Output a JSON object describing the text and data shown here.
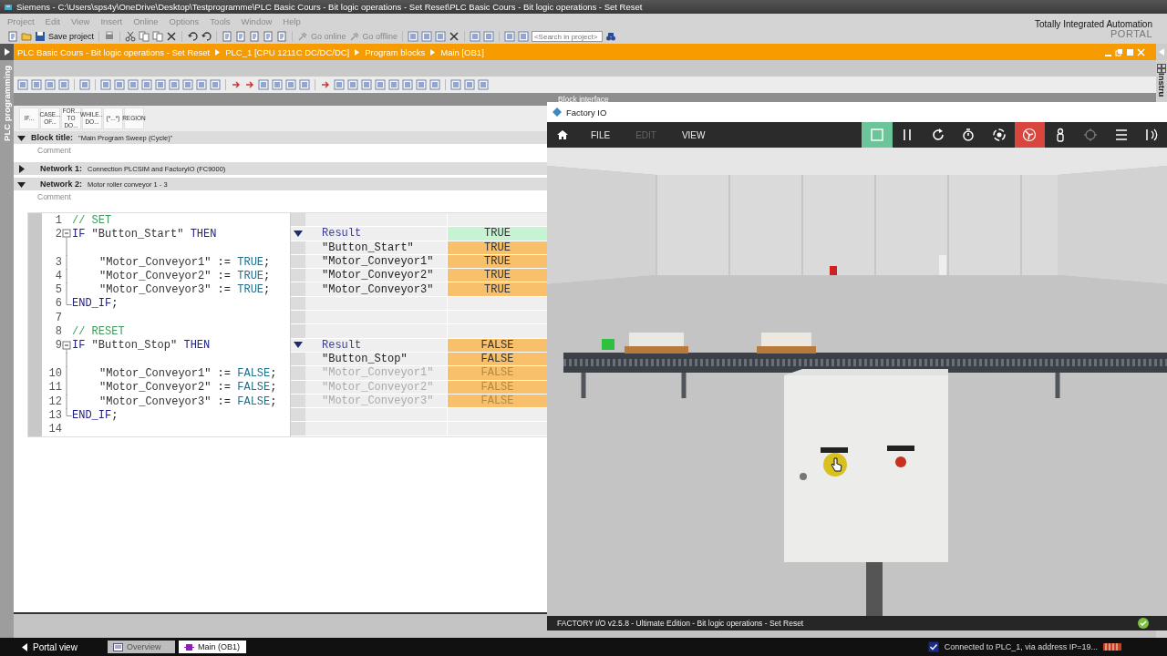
{
  "tia": {
    "title": "Siemens  -  C:\\Users\\sps4y\\OneDrive\\Desktop\\Testprogramme\\PLC Basic Cours - Bit logic operations - Set Reset\\PLC Basic Cours - Bit logic operations - Set Reset",
    "menu": [
      "Project",
      "Edit",
      "View",
      "Insert",
      "Online",
      "Options",
      "Tools",
      "Window",
      "Help"
    ],
    "save_label": "Save project",
    "go_online": "Go online",
    "go_offline": "Go offline",
    "search_placeholder": "<Search in project>",
    "brand": {
      "line1": "Totally Integrated Automation",
      "line2": "PORTAL"
    }
  },
  "breadcrumb": [
    "PLC Basic Cours - Bit logic operations - Set Reset",
    "PLC_1 [CPU 1211C DC/DC/DC]",
    "Program blocks",
    "Main [OB1]"
  ],
  "side_tab": "PLC programming",
  "right_tab": "Instru",
  "block_interface": "Block interface",
  "templates": [
    [
      "IF..."
    ],
    [
      "CASE...",
      "OF..."
    ],
    [
      "FOR...",
      "TO DO..."
    ],
    [
      "WHILE...",
      "DO..."
    ],
    [
      "(*...*)"
    ],
    [
      "REGION"
    ]
  ],
  "block_title": {
    "label": "Block title:",
    "value": "\"Main Program Sweep (Cycle)\"",
    "expanded": true,
    "comment": "Comment"
  },
  "networks": [
    {
      "label": "Network 1:",
      "title": "Connection PLCSIM and FactoryIO (FC9000)",
      "expanded": false
    },
    {
      "label": "Network 2:",
      "title": "Motor roller conveyor 1 - 3",
      "expanded": true,
      "comment": "Comment"
    }
  ],
  "code_lines": [
    {
      "number": "1",
      "kind": "plain",
      "tokens": [
        {
          "kind": "comment",
          "text": "// SET"
        }
      ]
    },
    {
      "number": "2",
      "kind": "block_start",
      "tokens": [
        {
          "kind": "keyword",
          "text": "IF"
        },
        {
          "kind": "string",
          "text": " \"Button_Start\""
        },
        {
          "kind": "keyword",
          "text": " THEN"
        }
      ]
    },
    {
      "number": "3",
      "kind": "block_inner",
      "tokens": [
        {
          "kind": "string",
          "text": "\"Motor_Conveyor1\""
        },
        {
          "kind": "plain",
          "text": " := "
        },
        {
          "kind": "constant",
          "text": "TRUE"
        },
        {
          "kind": "plain",
          "text": ";"
        }
      ]
    },
    {
      "number": "4",
      "kind": "block_inner",
      "tokens": [
        {
          "kind": "string",
          "text": "\"Motor_Conveyor2\""
        },
        {
          "kind": "plain",
          "text": " := "
        },
        {
          "kind": "constant",
          "text": "TRUE"
        },
        {
          "kind": "plain",
          "text": ";"
        }
      ]
    },
    {
      "number": "5",
      "kind": "block_inner",
      "tokens": [
        {
          "kind": "string",
          "text": "\"Motor_Conveyor3\""
        },
        {
          "kind": "plain",
          "text": " := "
        },
        {
          "kind": "constant",
          "text": "TRUE"
        },
        {
          "kind": "plain",
          "text": ";"
        }
      ]
    },
    {
      "number": "6",
      "kind": "block_end",
      "tokens": [
        {
          "kind": "keyword",
          "text": "END_IF"
        },
        {
          "kind": "plain",
          "text": ";"
        }
      ]
    },
    {
      "number": "7",
      "kind": "plain"
    },
    {
      "number": "8",
      "kind": "plain",
      "tokens": [
        {
          "kind": "comment",
          "text": "// RESET"
        }
      ]
    },
    {
      "number": "9",
      "kind": "block_start",
      "tokens": [
        {
          "kind": "keyword",
          "text": "IF"
        },
        {
          "kind": "string",
          "text": " \"Button_Stop\""
        },
        {
          "kind": "keyword",
          "text": " THEN"
        }
      ]
    },
    {
      "number": "10",
      "kind": "block_inner",
      "tokens": [
        {
          "kind": "string",
          "text": "\"Motor_Conveyor1\""
        },
        {
          "kind": "plain",
          "text": " := "
        },
        {
          "kind": "constant",
          "text": "FALSE"
        },
        {
          "kind": "plain",
          "text": ";"
        }
      ]
    },
    {
      "number": "11",
      "kind": "block_inner",
      "tokens": [
        {
          "kind": "string",
          "text": "\"Motor_Conveyor2\""
        },
        {
          "kind": "plain",
          "text": " := "
        },
        {
          "kind": "constant",
          "text": "FALSE"
        },
        {
          "kind": "plain",
          "text": ";"
        }
      ]
    },
    {
      "number": "12",
      "kind": "block_inner",
      "tokens": [
        {
          "kind": "string",
          "text": "\"Motor_Conveyor3\""
        },
        {
          "kind": "plain",
          "text": " := "
        },
        {
          "kind": "constant",
          "text": "FALSE"
        },
        {
          "kind": "plain",
          "text": ";"
        }
      ]
    },
    {
      "number": "13",
      "kind": "block_end",
      "tokens": [
        {
          "kind": "keyword",
          "text": "END_IF"
        },
        {
          "kind": "plain",
          "text": ";"
        }
      ]
    },
    {
      "number": "14",
      "kind": "plain"
    }
  ],
  "monitor_rows": [
    {
      "kind": "blank"
    },
    {
      "kind": "result",
      "operand": "Result",
      "value": "TRUE",
      "color": "#c6f3d2",
      "expanded": true,
      "disabled": false
    },
    {
      "kind": "operand",
      "operand": "\"Button_Start\"",
      "value": "TRUE",
      "color": "#f8c06a",
      "disabled": false
    },
    {
      "kind": "operand",
      "operand": "\"Motor_Conveyor1\"",
      "value": "TRUE",
      "color": "#f8c06a",
      "disabled": false
    },
    {
      "kind": "operand",
      "operand": "\"Motor_Conveyor2\"",
      "value": "TRUE",
      "color": "#f8c06a",
      "disabled": false
    },
    {
      "kind": "operand",
      "operand": "\"Motor_Conveyor3\"",
      "value": "TRUE",
      "color": "#f8c06a",
      "disabled": false
    },
    {
      "kind": "blank"
    },
    {
      "kind": "blank"
    },
    {
      "kind": "blank"
    },
    {
      "kind": "result",
      "operand": "Result",
      "value": "FALSE",
      "color": "#f8c06a",
      "expanded": true,
      "disabled": false
    },
    {
      "kind": "operand",
      "operand": "\"Button_Stop\"",
      "value": "FALSE",
      "color": "#f8c06a",
      "disabled": false
    },
    {
      "kind": "operand",
      "operand": "\"Motor_Conveyor1\"",
      "value": "FALSE",
      "color": "#f8c06a",
      "disabled": true
    },
    {
      "kind": "operand",
      "operand": "\"Motor_Conveyor2\"",
      "value": "FALSE",
      "color": "#f8c06a",
      "disabled": true
    },
    {
      "kind": "operand",
      "operand": "\"Motor_Conveyor3\"",
      "value": "FALSE",
      "color": "#f8c06a",
      "disabled": true
    },
    {
      "kind": "blank"
    },
    {
      "kind": "blank"
    }
  ],
  "factory_io": {
    "title": "Factory IO",
    "menu": [
      {
        "label": "FILE",
        "disabled": false
      },
      {
        "label": "EDIT",
        "disabled": true
      },
      {
        "label": "VIEW",
        "disabled": false
      }
    ],
    "tools": [
      {
        "kind": "stop",
        "color": "#6cc49a",
        "disabled": false
      },
      {
        "kind": "pause",
        "color": "#2b2b2b",
        "disabled": false
      },
      {
        "kind": "reset",
        "color": "#2b2b2b",
        "disabled": false
      },
      {
        "kind": "timer",
        "color": "#2b2b2b",
        "disabled": false
      },
      {
        "kind": "orbit",
        "color": "#2b2b2b",
        "disabled": false
      },
      {
        "kind": "fan",
        "color": "#d9463e",
        "disabled": false
      },
      {
        "kind": "person",
        "color": "#2b2b2b",
        "disabled": false
      },
      {
        "kind": "crosshair",
        "color": "#2b2b2b",
        "disabled": true
      },
      {
        "kind": "list",
        "color": "#2b2b2b",
        "disabled": false
      },
      {
        "kind": "antenna",
        "color": "#2b2b2b",
        "disabled": false
      }
    ],
    "status": "FACTORY I/O v2.5.8 - Ultimate Edition - Bit logic operations - Set Reset"
  },
  "taskbar": {
    "portal_view": "Portal view",
    "tabs": [
      {
        "label": "Overview",
        "selected": false
      },
      {
        "label": "Main (OB1)",
        "selected": true
      }
    ],
    "connection": "Connected to PLC_1, via address IP=19..."
  }
}
